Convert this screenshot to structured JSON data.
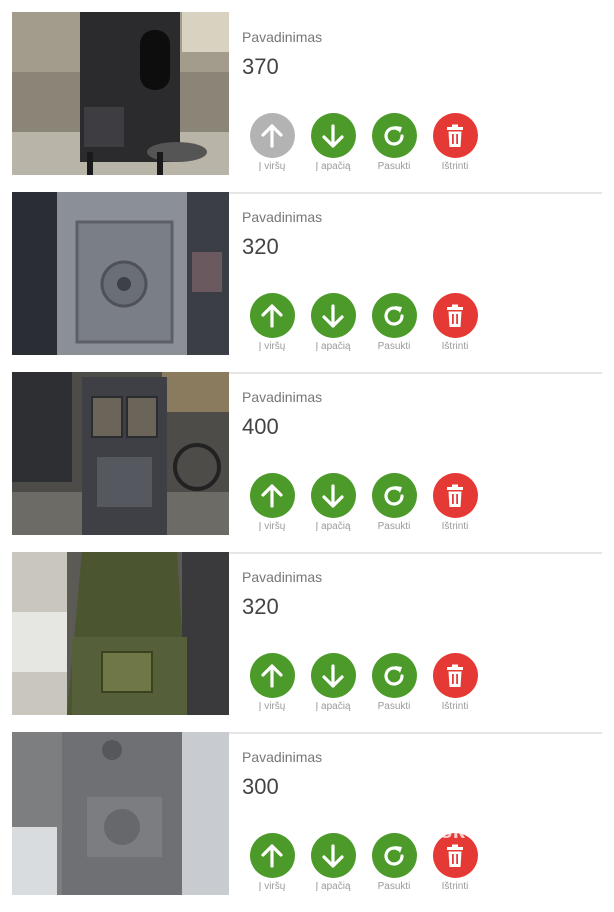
{
  "colors": {
    "green": "#4c9a2a",
    "gray": "#b3b3b3",
    "red": "#e53935"
  },
  "labels": {
    "up": "Į viršų",
    "down": "Į apačią",
    "rotate": "Pasukti",
    "delete": "Ištrinti"
  },
  "watermark": "skelbiu.lt",
  "items": [
    {
      "name_label": "Pavadinimas",
      "value": "370",
      "up_enabled": false
    },
    {
      "name_label": "Pavadinimas",
      "value": "320",
      "up_enabled": true
    },
    {
      "name_label": "Pavadinimas",
      "value": "400",
      "up_enabled": true
    },
    {
      "name_label": "Pavadinimas",
      "value": "320",
      "up_enabled": true
    },
    {
      "name_label": "Pavadinimas",
      "value": "300",
      "up_enabled": true
    }
  ],
  "icons": {
    "up": "arrow-up-icon",
    "down": "arrow-down-icon",
    "rotate": "rotate-icon",
    "delete": "trash-icon"
  }
}
